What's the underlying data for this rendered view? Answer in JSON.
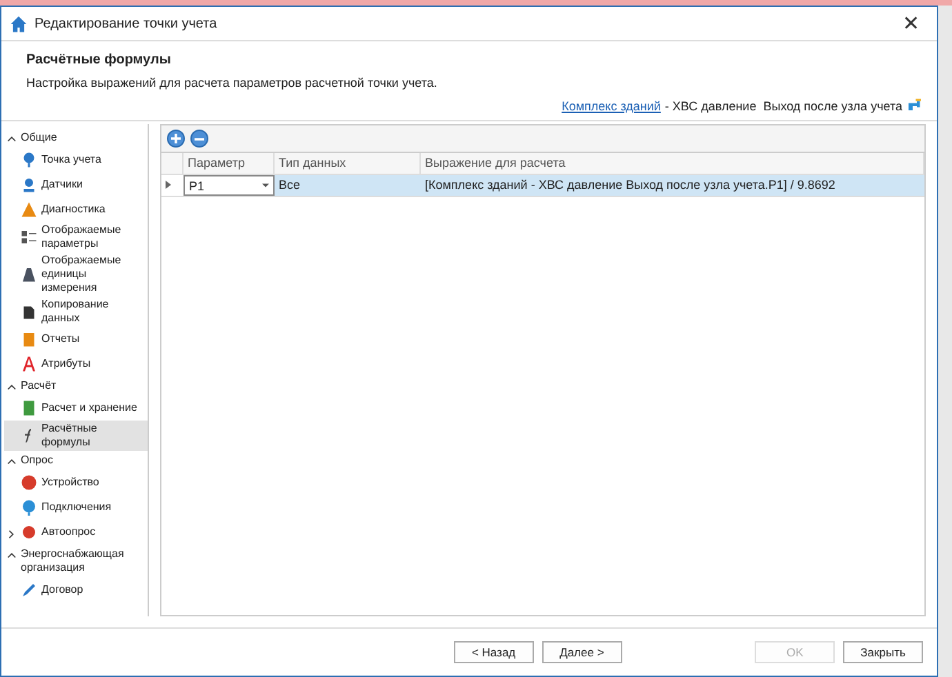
{
  "window": {
    "title": "Редактирование точки учета",
    "close": "✕"
  },
  "header": {
    "title": "Расчётные формулы",
    "description": "Настройка выражений для расчета параметров расчетной точки учета.",
    "link": "Комплекс зданий",
    "path": "- ХВС давление  Выход после узла учета"
  },
  "sidebar": {
    "groups": [
      {
        "label": "Общие",
        "expanded": true,
        "items": [
          {
            "label": "Точка учета",
            "selected": false
          },
          {
            "label": "Датчики",
            "selected": false
          },
          {
            "label": "Диагностика",
            "selected": false
          },
          {
            "label": "Отображаемые параметры",
            "selected": false
          },
          {
            "label": "Отображаемые единицы измерения",
            "selected": false
          },
          {
            "label": "Копирование данных",
            "selected": false
          },
          {
            "label": "Отчеты",
            "selected": false
          },
          {
            "label": "Атрибуты",
            "selected": false
          }
        ]
      },
      {
        "label": "Расчёт",
        "expanded": true,
        "items": [
          {
            "label": "Расчет и хранение",
            "selected": false
          },
          {
            "label": "Расчётные формулы",
            "selected": true
          }
        ]
      },
      {
        "label": "Опрос",
        "expanded": true,
        "items": [
          {
            "label": "Устройство",
            "selected": false
          },
          {
            "label": "Подключения",
            "selected": false
          },
          {
            "label": "Автоопрос",
            "selected": false,
            "expandable": true
          }
        ]
      },
      {
        "label": "Энергоснабжающая организация",
        "expanded": true,
        "items": [
          {
            "label": "Договор",
            "selected": false
          }
        ]
      }
    ]
  },
  "toolbar": {
    "buttons": [
      {
        "kind": "add"
      },
      {
        "kind": "remove"
      }
    ]
  },
  "table": {
    "columns": [
      "Параметр",
      "Тип данных",
      "Выражение для расчета"
    ],
    "rows": [
      {
        "parameter": "P1",
        "data_type": "Все",
        "expression": "[Комплекс зданий - ХВС давление  Выход после узла учета.P1] / 9.8692",
        "selected": true
      }
    ]
  },
  "footer": {
    "buttons": [
      {
        "label": "< Назад",
        "disabled": false
      },
      {
        "label": "Далее >",
        "disabled": false
      },
      {
        "label": "OK",
        "disabled": true
      },
      {
        "label": "Закрыть",
        "disabled": false
      }
    ]
  }
}
